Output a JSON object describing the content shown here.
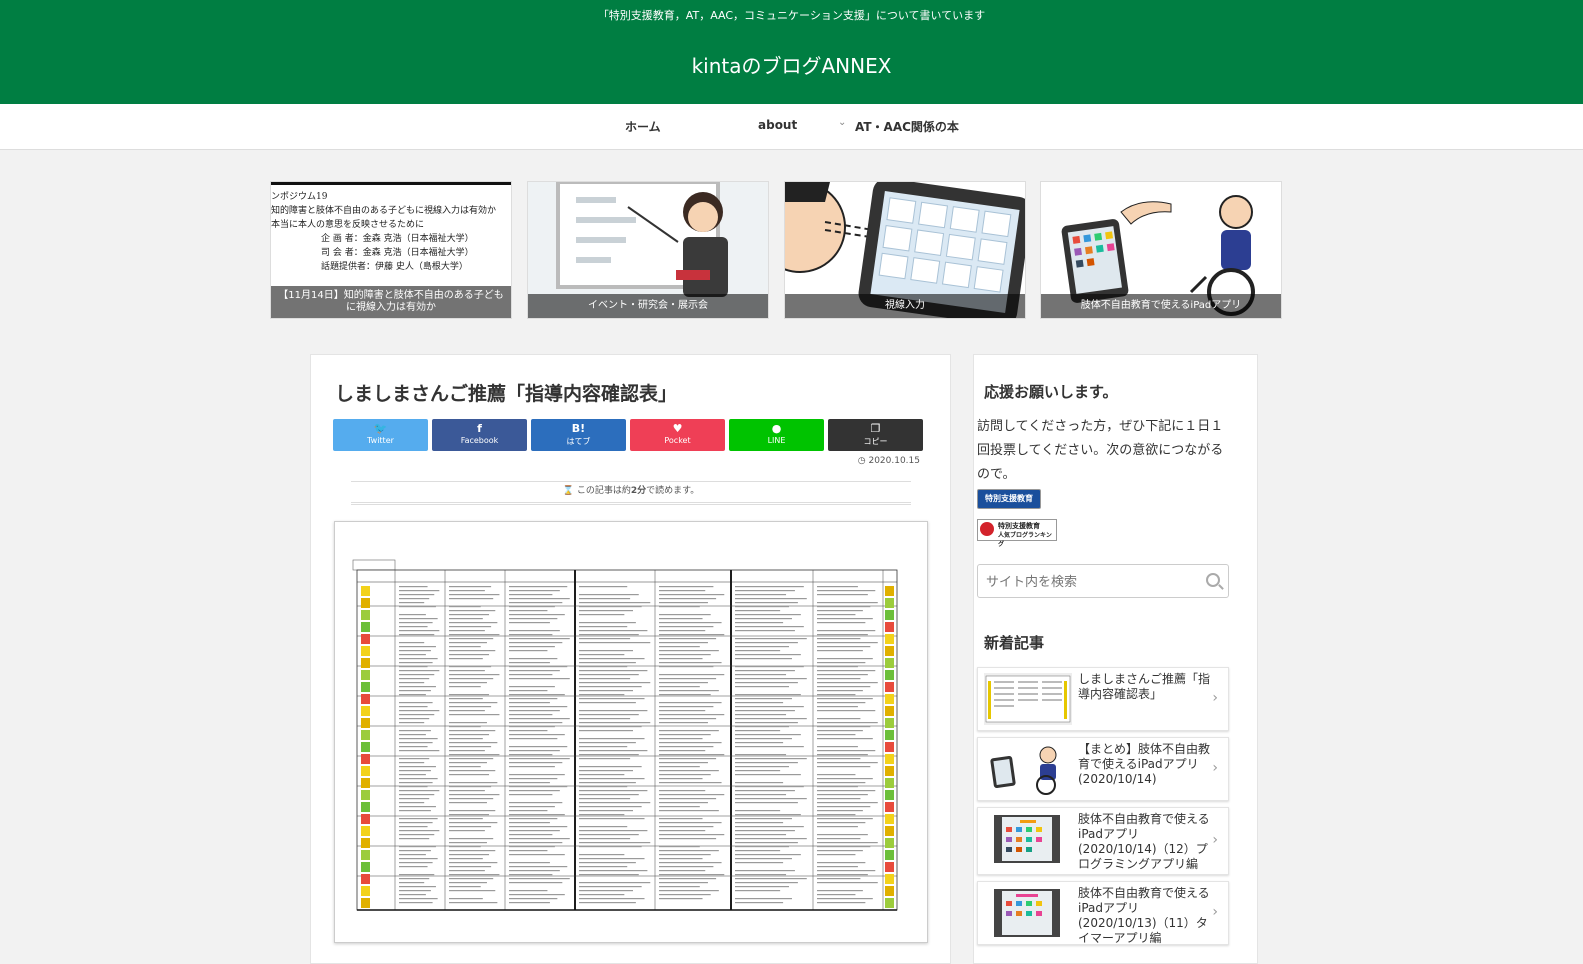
{
  "header": {
    "tagline": "「特別支援教育，AT，AAC，コミュニケーション支援」について書いています",
    "site_title": "kintaのブログANNEX"
  },
  "nav": {
    "home": "ホーム",
    "about": "about",
    "books": "AT・AAC関係の本"
  },
  "cards": [
    {
      "caption": "【11月14日】知的障害と肢体不自由のある子どもに視線入力は有効か",
      "doc_lines": [
        "ンポジウム19",
        "知的障害と肢体不自由のある子どもに視線入力は有効か",
        "本当に本人の意思を反映させるために",
        "企 画 者：金森 克浩（日本福祉大学）",
        "司 会 者：金森 克浩（日本福祉大学）",
        "話題提供者：伊藤 史人（島根大学）"
      ]
    },
    {
      "caption": "イベント・研究会・展示会"
    },
    {
      "caption": "視線入力"
    },
    {
      "caption": "肢体不自由教育で使えるiPadアプリ"
    }
  ],
  "post": {
    "title": "しましまさんご推薦「指導内容確認表」",
    "share": [
      {
        "icon": "twitter-icon",
        "glyph": "🐦",
        "label": "Twitter",
        "color": "#55acee"
      },
      {
        "icon": "facebook-icon",
        "glyph": "f",
        "label": "Facebook",
        "color": "#3b5998"
      },
      {
        "icon": "hatena-icon",
        "glyph": "B!",
        "label": "はてブ",
        "color": "#2c6ebd"
      },
      {
        "icon": "pocket-icon",
        "glyph": "♥",
        "label": "Pocket",
        "color": "#ef3f56"
      },
      {
        "icon": "line-icon",
        "glyph": "●",
        "label": "LINE",
        "color": "#00c300"
      },
      {
        "icon": "copy-icon",
        "glyph": "❐",
        "label": "コピー",
        "color": "#333333"
      }
    ],
    "date": "2020.10.15",
    "read_time_pre": "この記事は約",
    "read_time_val": "2分",
    "read_time_post": "で読めます。"
  },
  "sidebar": {
    "support_title": "応援お願いします。",
    "support_text": "訪問してくださった方，ぜひ下記に１日１回投票してください。次の意欲につながるので。",
    "badge1": "特別支援教育",
    "badge2_line1": "特別支援教育",
    "badge2_line2": "人気ブログランキング",
    "search_placeholder": "サイト内を検索",
    "recent_title": "新着記事",
    "recent": [
      {
        "title": "しましまさんご推薦「指導内容確認表」"
      },
      {
        "title": "【まとめ】肢体不自由教育で使えるiPadアプリ(2020/10/14)"
      },
      {
        "title": "肢体不自由教育で使えるiPadアプリ(2020/10/14)（12）プログラミングアプリ編"
      },
      {
        "title": "肢体不自由教育で使えるiPadアプリ(2020/10/13)（11）タイマーアプリ編"
      }
    ]
  },
  "colors": {
    "header_bg": "#007e42"
  }
}
